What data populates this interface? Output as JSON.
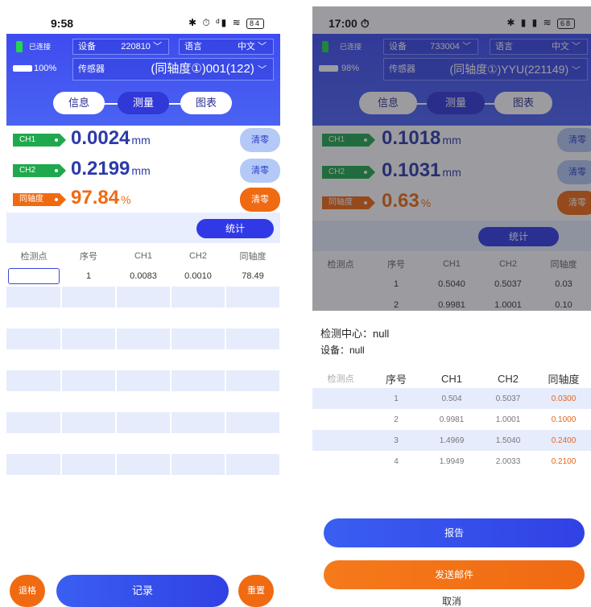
{
  "left": {
    "status": {
      "time": "9:58",
      "icons": "✱ ⏱ ᵈ▮ ≋",
      "battery": "84"
    },
    "connected": "已连接",
    "device_label": "设备",
    "device_value": "220810",
    "language_label": "语言",
    "language_value": "中文",
    "battery_percent": "100%",
    "sensor_label": "传感器",
    "sensor_value": "(同轴度①)001(122)",
    "tabs": [
      "信息",
      "测量",
      "图表"
    ],
    "channels": [
      {
        "tag": "CH1",
        "value": "0.0024",
        "unit": "mm",
        "clear": "清零"
      },
      {
        "tag": "CH2",
        "value": "0.2199",
        "unit": "mm",
        "clear": "清零"
      },
      {
        "tag": "同轴度",
        "value": "97.84",
        "unit": "%",
        "clear": "清零"
      }
    ],
    "stats_button": "统计",
    "table": {
      "headers": [
        "检测点",
        "序号",
        "CH1",
        "CH2",
        "同轴度"
      ],
      "row": {
        "no": "1",
        "ch1": "0.0083",
        "ch2": "0.0010",
        "ratio": "78.49"
      }
    },
    "bottom": {
      "reject": "退格",
      "record": "记录",
      "reset": "重置"
    }
  },
  "right": {
    "status": {
      "time": "17:00 ⏱",
      "icons": "✱ ▮ ▮ ≋",
      "battery": "68"
    },
    "connected": "已连接",
    "device_label": "设备",
    "device_value": "733004",
    "language_label": "语言",
    "language_value": "中文",
    "battery_percent": "98%",
    "sensor_label": "传感器",
    "sensor_value": "(同轴度①)YYU(221149)",
    "tabs": [
      "信息",
      "测量",
      "图表"
    ],
    "channels": [
      {
        "tag": "CH1",
        "value": "0.1018",
        "unit": "mm",
        "clear": "清零"
      },
      {
        "tag": "CH2",
        "value": "0.1031",
        "unit": "mm",
        "clear": "清零"
      },
      {
        "tag": "同轴度",
        "value": "0.63",
        "unit": "%",
        "clear": "清零"
      }
    ],
    "stats_button": "统计",
    "bg_table": {
      "headers": [
        "检测点",
        "序号",
        "CH1",
        "CH2",
        "同轴度"
      ],
      "rows": [
        {
          "no": "1",
          "ch1": "0.5040",
          "ch2": "0.5037",
          "ratio": "0.03"
        },
        {
          "no": "2",
          "ch1": "0.9981",
          "ch2": "1.0001",
          "ratio": "0.10"
        }
      ]
    },
    "sheet": {
      "center": "检测中心：null",
      "device": "设备：null",
      "headers": [
        "检测点",
        "序号",
        "CH1",
        "CH2",
        "同轴度"
      ],
      "rows": [
        {
          "no": "1",
          "ch1": "0.504",
          "ch2": "0.5037",
          "ratio": "0.0300"
        },
        {
          "no": "2",
          "ch1": "0.9981",
          "ch2": "1.0001",
          "ratio": "0.1000"
        },
        {
          "no": "3",
          "ch1": "1.4969",
          "ch2": "1.5040",
          "ratio": "0.2400"
        },
        {
          "no": "4",
          "ch1": "1.9949",
          "ch2": "2.0033",
          "ratio": "0.2100"
        }
      ],
      "report_button": "报告",
      "email_button": "发送邮件",
      "cancel": "取消"
    }
  },
  "colors": {
    "header_blue": "#3b45ef",
    "accent_orange": "#f06a12",
    "green": "#1fa84d",
    "value_blue": "#2d3aa8"
  }
}
